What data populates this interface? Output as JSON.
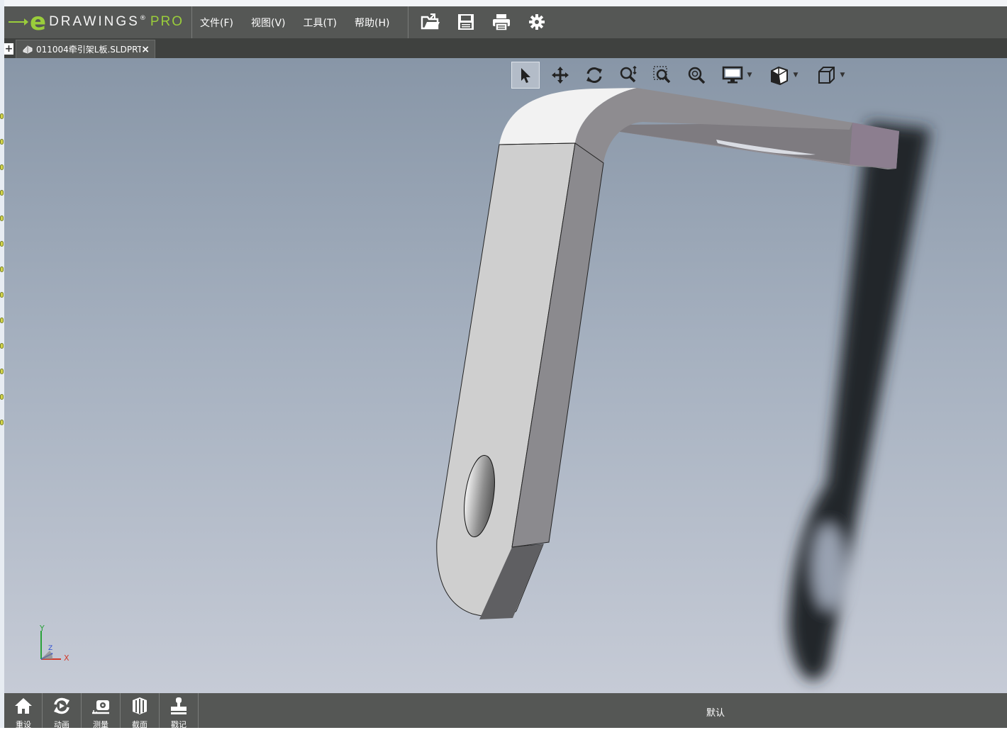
{
  "app": {
    "logo_e": "e",
    "logo_text": "DRAWINGS",
    "logo_reg": "®",
    "logo_pro": "PRO",
    "accent_color": "#9acd3b",
    "titlebar_color": "#555755"
  },
  "menu": {
    "items": [
      "文件(F)",
      "视图(V)",
      "工具(T)",
      "帮助(H)"
    ]
  },
  "toolbar": {
    "icons": [
      "open-folder-icon",
      "save-icon",
      "print-icon",
      "settings-gear-icon"
    ]
  },
  "tabs": {
    "add_label": "+",
    "items": [
      {
        "label": "011004牵引架L板.SLDPRT",
        "close": "×",
        "icon": "part-file-icon"
      }
    ]
  },
  "view_toolbar": {
    "tools": [
      "select-arrow-icon",
      "pan-icon",
      "rotate-icon",
      "zoom-icon",
      "zoom-to-area-icon",
      "zoom-to-fit-icon",
      "display-style-icon",
      "section-view-icon",
      "standard-views-icon"
    ],
    "active": "select-arrow-icon"
  },
  "triad": {
    "x_label": "X",
    "y_label": "Y",
    "z_label": "Z"
  },
  "bottom_toolbar": {
    "buttons": [
      {
        "label": "重设",
        "icon": "home-icon"
      },
      {
        "label": "动画",
        "icon": "animate-icon"
      },
      {
        "label": "测量",
        "icon": "measure-icon"
      },
      {
        "label": "截面",
        "icon": "section-icon"
      },
      {
        "label": "戳记",
        "icon": "stamp-icon"
      }
    ],
    "configuration": "默认"
  }
}
